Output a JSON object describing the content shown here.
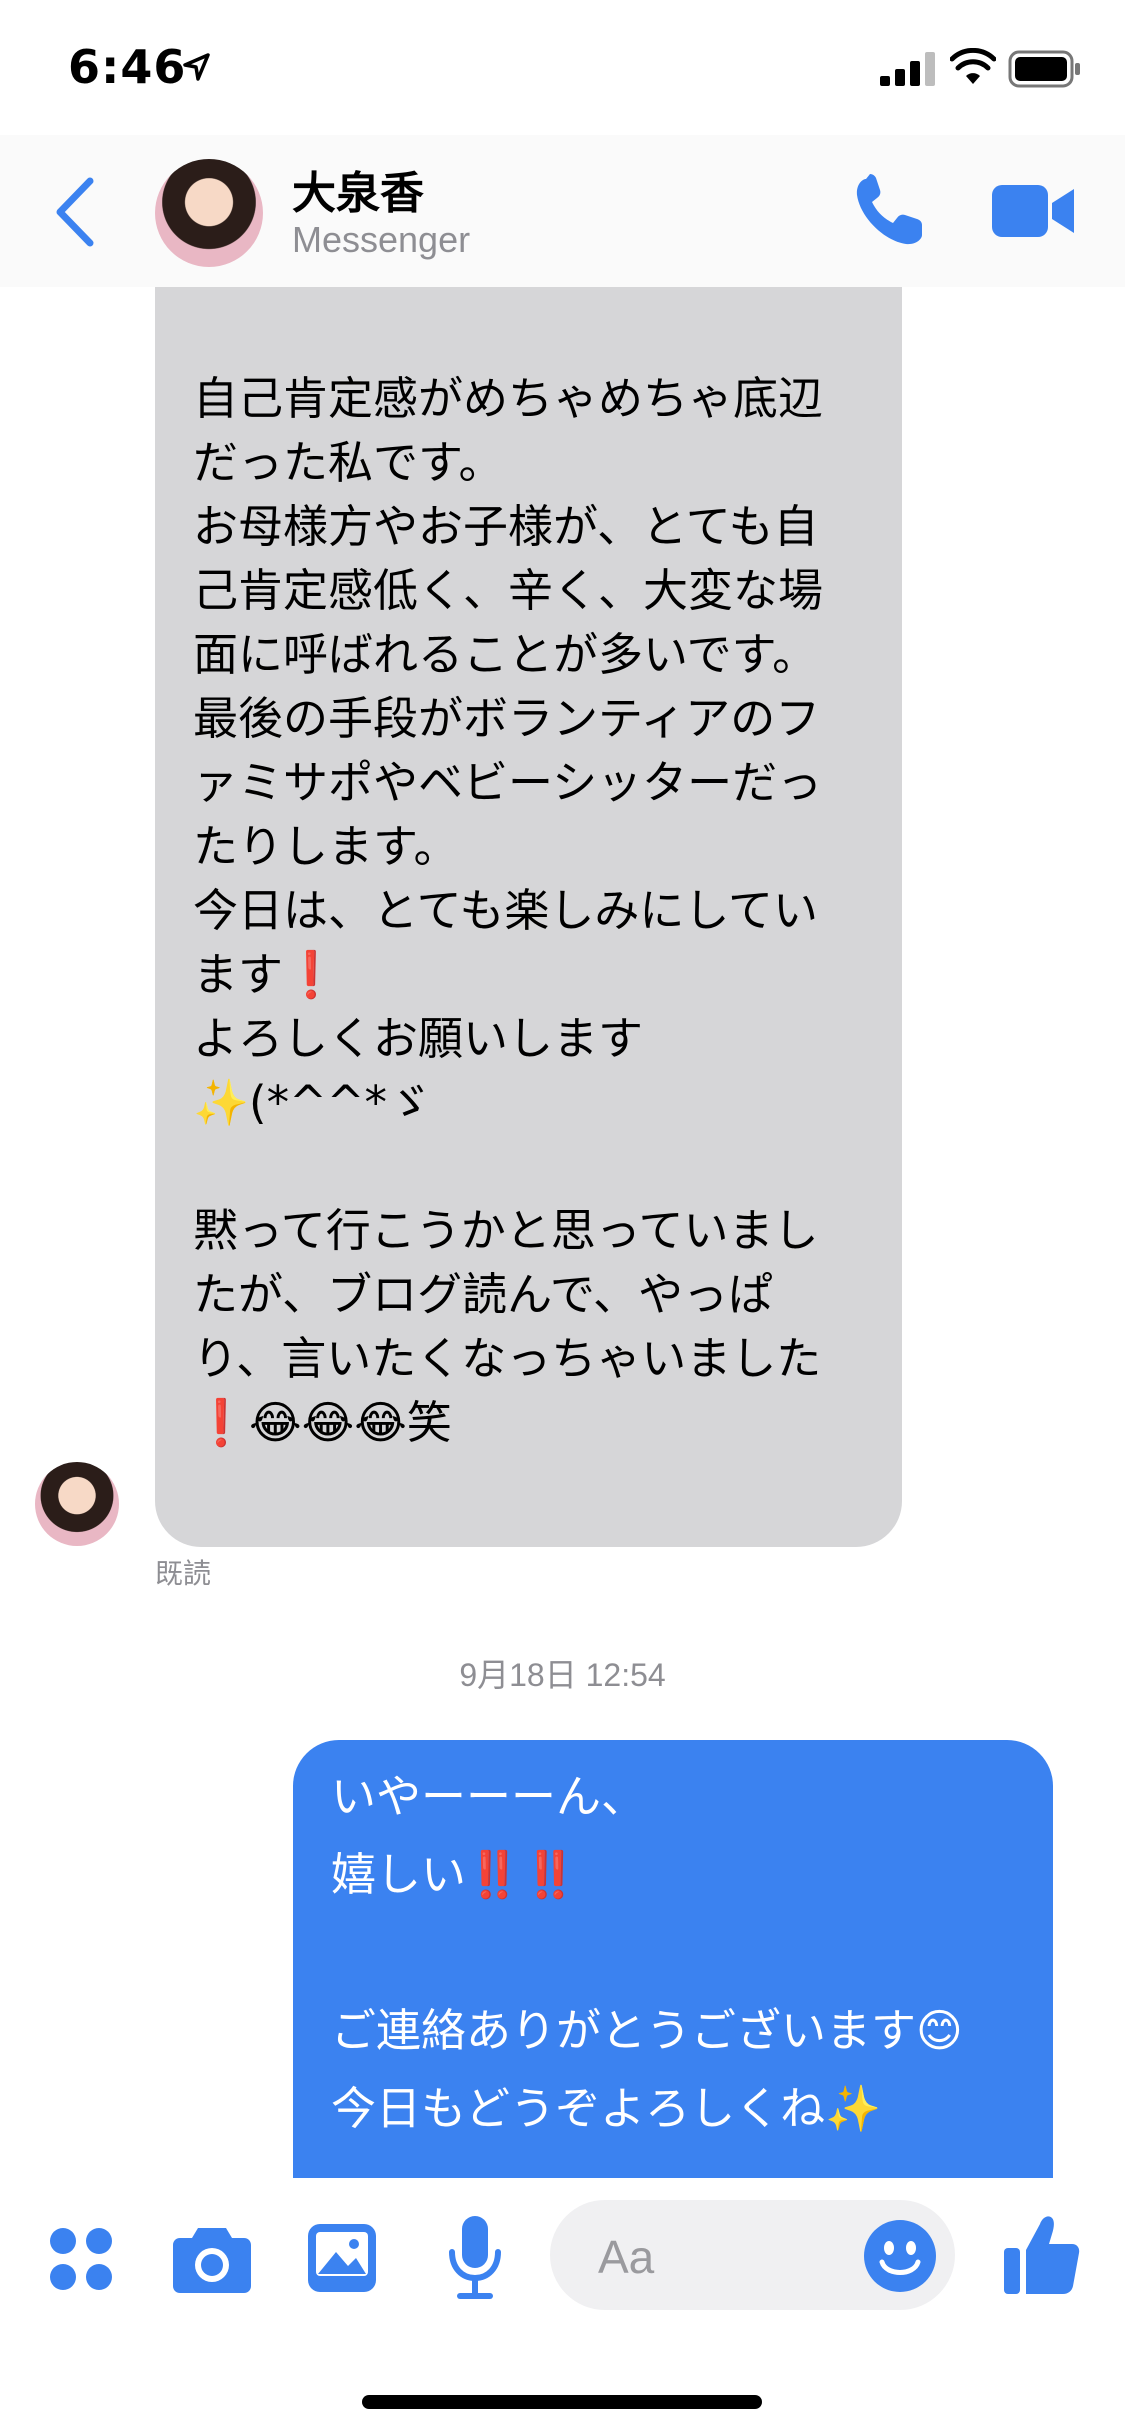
{
  "status_bar": {
    "time": "6:46"
  },
  "header": {
    "contact_name": "大泉香",
    "contact_subtitle": "Messenger"
  },
  "messages": {
    "incoming_text": "自己肯定感がめちゃめちゃ底辺\nだった私です。\nお母様方やお子様が、とても自\n己肯定感低く、辛く、大変な場\n面に呼ばれることが多いです。\n最後の手段がボランティアのフ\nァミサポやベビーシッターだっ\nたりします。\n今日は、とても楽しみにしてい\nます❗\nよろしくお願いします\n✨(*^^*ゞ\n\n黙って行こうかと思っていまし\nたが、ブログ読んで、やっぱ\nり、言いたくなっちゃいました\n❗😂😂😂笑",
    "read_receipt": "既読",
    "timestamp": "9月18日 12:54",
    "outgoing_text": "いやーーーん、\n嬉しい‼️‼️\n\nご連絡ありがとうございます😊\n今日もどうぞよろしくね✨"
  },
  "composer": {
    "placeholder": "Aa"
  },
  "colors": {
    "accent": "#3b82f0",
    "incoming_bubble": "#d6d6d8",
    "secondary_text": "#8e8e93"
  },
  "icons": [
    "location-arrow-icon",
    "signal-icon",
    "wifi-icon",
    "battery-icon",
    "back-chevron-icon",
    "phone-icon",
    "video-camera-icon",
    "apps-grid-icon",
    "camera-icon",
    "gallery-icon",
    "microphone-icon",
    "emoji-icon",
    "thumbs-up-icon"
  ]
}
